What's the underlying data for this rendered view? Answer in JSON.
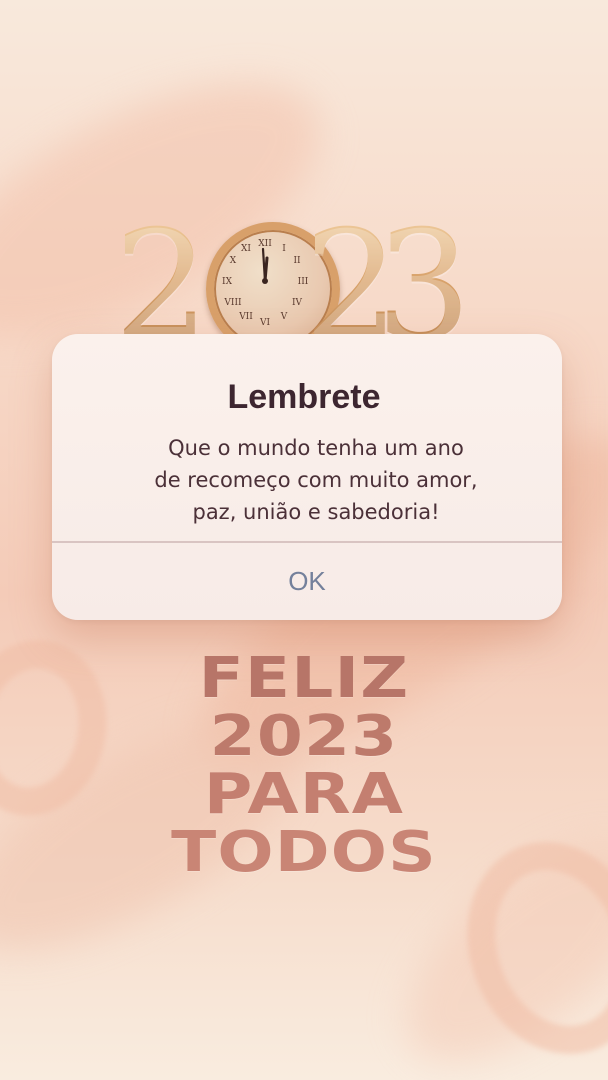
{
  "headline": {
    "year_first": "2",
    "year_second": "2",
    "year_third": "3",
    "clock_icon": "clock-icon"
  },
  "dialog": {
    "title": "Lembrete",
    "message": "Que o mundo tenha um ano\nde recomeço com muito amor,\npaz, união e sabedoria!",
    "ok_label": "OK"
  },
  "tagline": {
    "line1": "FELIZ",
    "line2": "2023",
    "line3": "PARA",
    "line4": "TODOS"
  },
  "colors": {
    "background": "#f7d9c8",
    "gold": "#d9a36b",
    "dialog_title": "#3d2630",
    "ok_text": "#74809b",
    "tagline": "#c57c70"
  }
}
